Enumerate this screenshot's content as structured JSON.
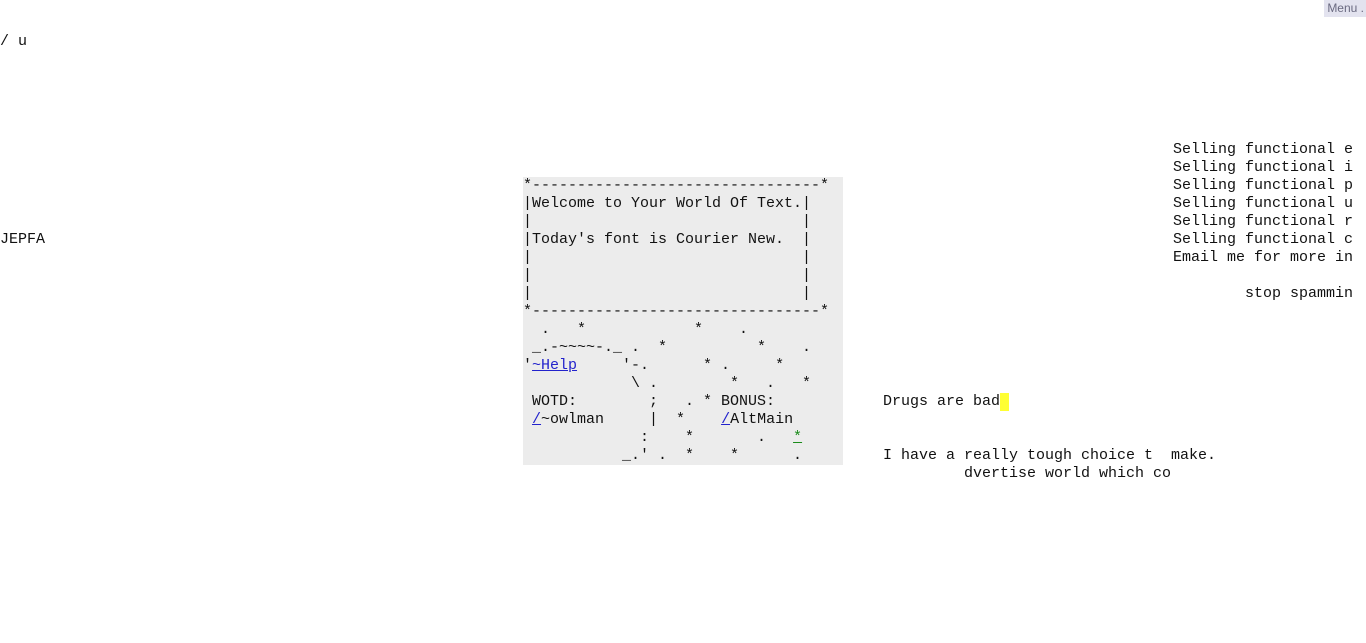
{
  "menu": {
    "label": "Menu ."
  },
  "fragments": {
    "top_left": "/ u",
    "mid_left": "JEPFA"
  },
  "panel": {
    "lines": [
      "*--------------------------------*",
      "|Welcome to Your World Of Text.|",
      "|                              |",
      "|Today's font is Courier New.  |",
      "|                              |",
      "|                              |",
      "|                              |",
      "*--------------------------------*",
      "  .   *            *    .",
      " _.-~~~~-._ .  *          *    .",
      "'",
      "            \\ .        *   .   *",
      " WOTD:        ;   . * BONUS:",
      "",
      "             :    *       .   ",
      "           _.' .  *    *      ."
    ],
    "help_link": "~Help",
    "help_rest": "     '-.      * .     *",
    "owl_link": "/",
    "owl_rest": "~owlman     |  *    ",
    "altmain_link": "/",
    "altmain_rest": "AltMain",
    "star_link": "*"
  },
  "right_block": {
    "lines": [
      "Selling functional e",
      "Selling functional i",
      "Selling functional p",
      "Selling functional u",
      "Selling functional r",
      "Selling functional c",
      "Email me for more in",
      "",
      "        stop spammin"
    ]
  },
  "center_texts": {
    "drugs": "Drugs are bad",
    "choice_line1": "I have a really tough choice t  make.",
    "choice_line2": "         dvertise world which co"
  },
  "colors": {
    "panel_bg": "#ececec",
    "link": "#2222cc",
    "link_green": "#1a8c1a",
    "cursor": "#ffff33"
  }
}
